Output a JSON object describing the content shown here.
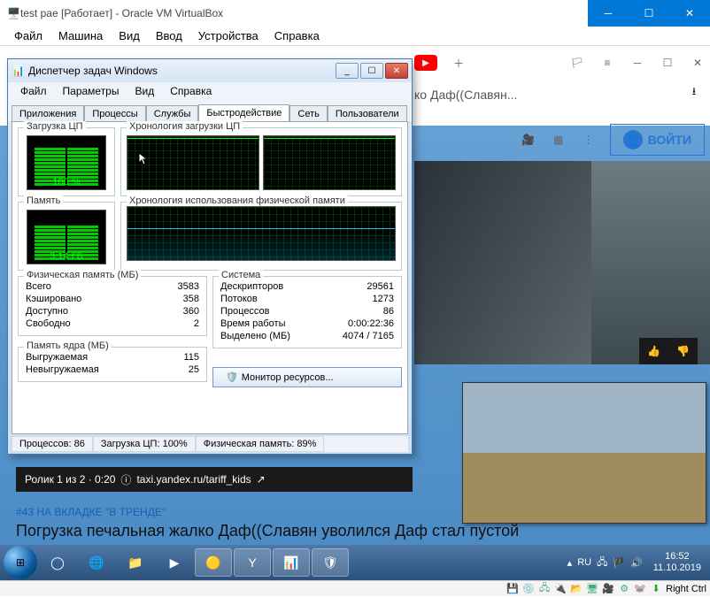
{
  "vbox": {
    "title": "test pae [Работает] - Oracle VM VirtualBox",
    "menu": [
      "Файл",
      "Машина",
      "Вид",
      "Ввод",
      "Устройства",
      "Справка"
    ],
    "status_host_key": "Right Ctrl"
  },
  "browser": {
    "address": "ко Даф((Славян...",
    "login": "ВОЙТИ"
  },
  "ad": {
    "counter": "Ролик 1 из 2 · 0:20",
    "link": "taxi.yandex.ru/tariff_kids"
  },
  "trend": {
    "tag": "#43 НА ВКЛАДКЕ \"В ТРЕНДЕ\"",
    "title": "Погрузка печальная жалко Даф((Славян уволился Даф стал пустой"
  },
  "tm": {
    "title": "Диспетчер задач Windows",
    "menu": [
      "Файл",
      "Параметры",
      "Вид",
      "Справка"
    ],
    "tabs": [
      "Приложения",
      "Процессы",
      "Службы",
      "Быстродействие",
      "Сеть",
      "Пользователи"
    ],
    "active_tab": 3,
    "cpu_group": "Загрузка ЦП",
    "cpu_hist_group": "Хронология загрузки ЦП",
    "mem_group": "Память",
    "mem_hist_group": "Хронология использования физической памяти",
    "cpu_pct": "100 %",
    "mem_val": "3,14 ГБ",
    "phys_group": "Физическая память (МБ)",
    "phys": {
      "total_l": "Всего",
      "total_v": "3583",
      "cached_l": "Кэшировано",
      "cached_v": "358",
      "avail_l": "Доступно",
      "avail_v": "360",
      "free_l": "Свободно",
      "free_v": "2"
    },
    "kernel_group": "Память ядра (МБ)",
    "kernel": {
      "paged_l": "Выгружаемая",
      "paged_v": "115",
      "nonpaged_l": "Невыгружаемая",
      "nonpaged_v": "25"
    },
    "sys_group": "Система",
    "sys": {
      "handles_l": "Дескрипторов",
      "handles_v": "29561",
      "threads_l": "Потоков",
      "threads_v": "1273",
      "procs_l": "Процессов",
      "procs_v": "86",
      "uptime_l": "Время работы",
      "uptime_v": "0:00:22:36",
      "commit_l": "Выделено (МБ)",
      "commit_v": "4074 / 7165"
    },
    "resmon": "Монитор ресурсов...",
    "status": {
      "procs": "Процессов: 86",
      "cpu": "Загрузка ЦП: 100%",
      "mem": "Физическая память: 89%"
    }
  },
  "tray": {
    "lang": "RU",
    "time": "16:52",
    "date": "11.10.2019"
  }
}
